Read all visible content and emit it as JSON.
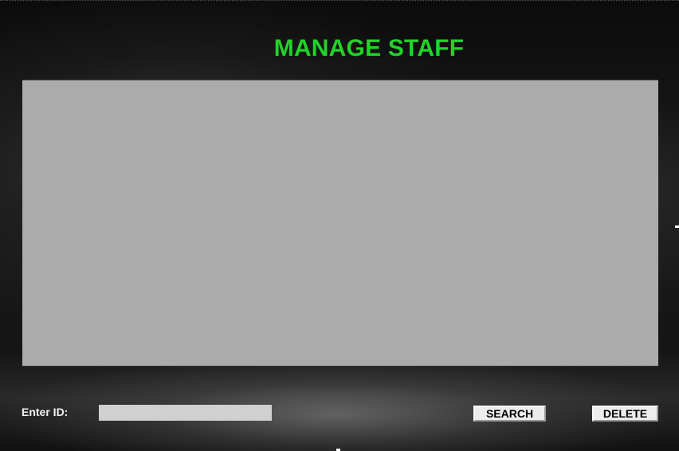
{
  "window": {
    "title": "MANAGE STAFF"
  },
  "table": {
    "rows": []
  },
  "form": {
    "id_label": "Enter ID:",
    "id_value": "",
    "id_placeholder": "",
    "search_label": "SEARCH",
    "delete_label": "DELETE"
  },
  "colors": {
    "title": "#22d32a",
    "table_background": "#ababab",
    "input_background": "#d0d0d0",
    "button_background": "#ececec"
  }
}
